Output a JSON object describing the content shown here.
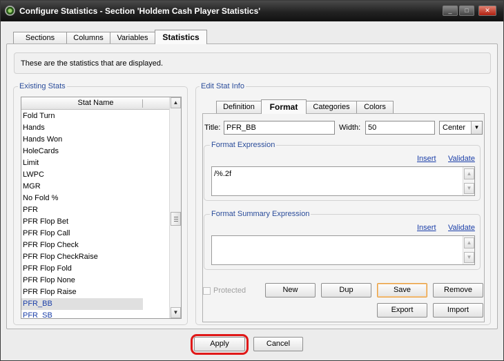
{
  "window": {
    "title": "Configure Statistics - Section 'Holdem Cash Player Statistics'",
    "controls": {
      "minimize": "_",
      "maximize": "□",
      "close": "✕"
    }
  },
  "main_tabs": [
    {
      "label": "Sections"
    },
    {
      "label": "Columns"
    },
    {
      "label": "Variables"
    },
    {
      "label": "Statistics"
    }
  ],
  "info_text": "These are the statistics that are displayed.",
  "existing_stats": {
    "group_label": "Existing Stats",
    "column_header": "Stat Name",
    "items": [
      {
        "label": "Fold Turn"
      },
      {
        "label": "Hands"
      },
      {
        "label": "Hands Won"
      },
      {
        "label": "HoleCards"
      },
      {
        "label": "Limit"
      },
      {
        "label": "LWPC"
      },
      {
        "label": "MGR"
      },
      {
        "label": "No Fold %"
      },
      {
        "label": "PFR"
      },
      {
        "label": "PFR Flop Bet"
      },
      {
        "label": "PFR Flop Call"
      },
      {
        "label": "PFR Flop Check"
      },
      {
        "label": "PFR Flop CheckRaise"
      },
      {
        "label": "PFR Flop Fold"
      },
      {
        "label": "PFR Flop None"
      },
      {
        "label": "PFR Flop Raise"
      },
      {
        "label": "PFR_BB"
      },
      {
        "label": "PFR_SB"
      }
    ],
    "selected": "PFR_BB"
  },
  "edit_stat": {
    "group_label": "Edit Stat Info",
    "tabs": [
      {
        "label": "Definition"
      },
      {
        "label": "Format"
      },
      {
        "label": "Categories"
      },
      {
        "label": "Colors"
      }
    ],
    "title_label": "Title:",
    "title_value": "PFR_BB",
    "width_label": "Width:",
    "width_value": "50",
    "align_value": "Center",
    "format_expression": {
      "label": "Format Expression",
      "insert": "Insert",
      "validate": "Validate",
      "value": "/%.2f"
    },
    "format_summary_expression": {
      "label": "Format Summary Expression",
      "insert": "Insert",
      "validate": "Validate",
      "value": ""
    },
    "protected_label": "Protected",
    "buttons": {
      "new": "New",
      "dup": "Dup",
      "save": "Save",
      "remove": "Remove",
      "export": "Export",
      "import": "Import"
    }
  },
  "footer": {
    "apply": "Apply",
    "cancel": "Cancel"
  }
}
